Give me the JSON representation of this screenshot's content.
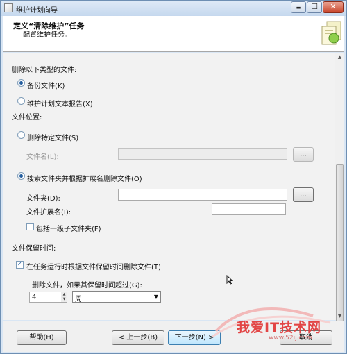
{
  "window": {
    "title": "维护计划向导",
    "controls": {
      "minimize": "▬",
      "maximize": "☐",
      "close": "✕"
    }
  },
  "header": {
    "title": "定义“清除维护”任务",
    "subtitle": "配置维护任务。"
  },
  "section_delete_types": {
    "label": "删除以下类型的文件:",
    "options": [
      {
        "label": "备份文件(K)",
        "selected": true
      },
      {
        "label": "维护计划文本报告(X)",
        "selected": false
      }
    ]
  },
  "section_location": {
    "label": "文件位置:",
    "option_specific": {
      "label": "删除特定文件(S)",
      "selected": false
    },
    "filename": {
      "label": "文件名(L):",
      "value": "",
      "browse_label": "..."
    },
    "option_search": {
      "label": "搜索文件夹并根据扩展名删除文件(O)",
      "selected": true
    },
    "folder": {
      "label": "文件夹(D):",
      "value": "",
      "browse_label": "..."
    },
    "extension": {
      "label": "文件扩展名(I):",
      "value": ""
    },
    "include_subfolders": {
      "label": "包括一级子文件夹(F)",
      "checked": false
    }
  },
  "section_retention": {
    "label": "文件保留时间:",
    "delete_by_age": {
      "label": "在任务运行时根据文件保留时间删除文件(T)",
      "checked": true
    },
    "older_than_label": "删除文件，如果其保留时间超过(G):",
    "amount": "4",
    "unit": "周"
  },
  "footer": {
    "help": "帮助(H)",
    "back": "< 上一步(B)",
    "next": "下一步(N) >",
    "cancel": "取消"
  },
  "watermark": {
    "main": "我爱IT技术网",
    "url": "www.52ij.com"
  },
  "colors": {
    "accent": "#235d9e",
    "window_frame": "#6e8fb3",
    "close_button": "#c9442a",
    "watermark": "#e23c3c"
  }
}
